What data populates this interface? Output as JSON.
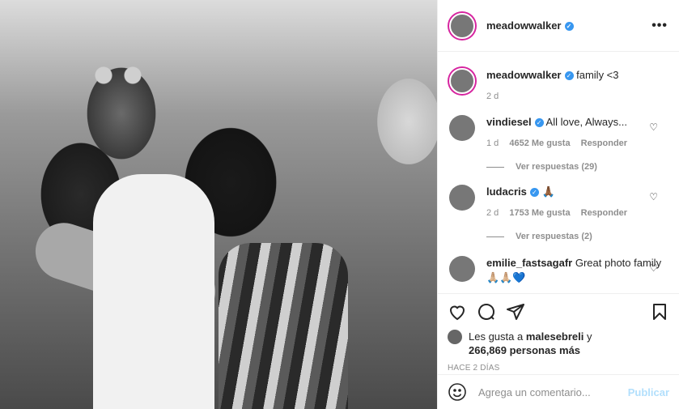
{
  "post": {
    "username": "meadowwalker",
    "verified_icon": "verified-badge-icon",
    "more_icon": "more-options-icon"
  },
  "caption": {
    "username": "meadowwalker",
    "text": "family <3",
    "age": "2 d"
  },
  "comments": [
    {
      "username": "vindiesel",
      "text": "All love, Always...",
      "age": "1 d",
      "likes": "4652 Me gusta",
      "reply": "Responder",
      "view_replies": "Ver respuestas (29)"
    },
    {
      "username": "ludacris",
      "text": "🙏🏾",
      "age": "2 d",
      "likes": "1753 Me gusta",
      "reply": "Responder",
      "view_replies": "Ver respuestas (2)"
    },
    {
      "username": "emilie_fastsagafr",
      "text": "Great photo family 🙏🏼🙏🏼💙"
    }
  ],
  "likes": {
    "prefix": "Les gusta a",
    "user": "malesebreli",
    "joiner": "y",
    "others": "266,869 personas más"
  },
  "timestamp": "HACE 2 DÍAS",
  "add_comment": {
    "placeholder": "Agrega un comentario...",
    "post_label": "Publicar"
  },
  "colors": {
    "story_ring": "#d6249f",
    "verified": "#3897f0",
    "muted": "#8e8e8e",
    "post_disabled": "#b2dffc"
  }
}
